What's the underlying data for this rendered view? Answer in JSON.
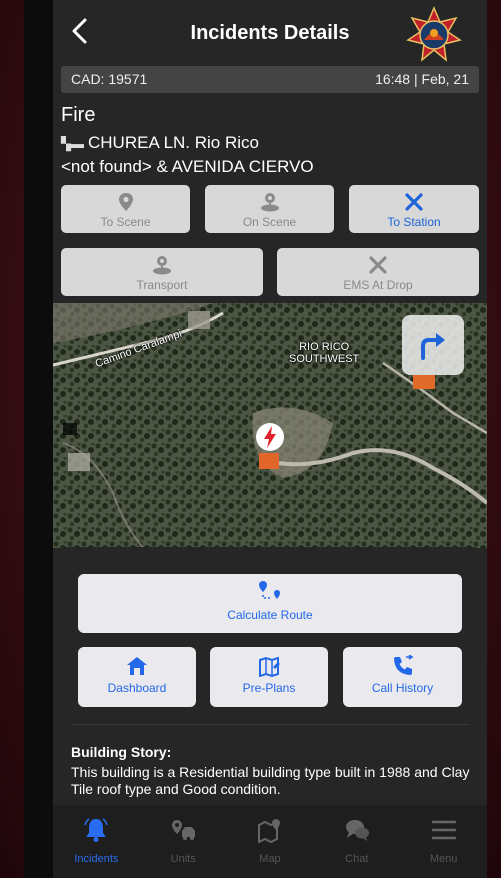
{
  "header": {
    "title": "Incidents Details"
  },
  "cad_bar": {
    "cad": "CAD: 19571",
    "time": "16:48 | Feb, 21"
  },
  "incident": {
    "type": "Fire",
    "address_line1": "CHUREA LN. Rio Rico",
    "address_line2": "<not found> & AVENIDA CIERVO"
  },
  "status_buttons": [
    {
      "label": "To Scene",
      "icon": "location-pin-icon",
      "active": false
    },
    {
      "label": "On Scene",
      "icon": "person-pin-icon",
      "active": false
    },
    {
      "label": "To Station",
      "icon": "close-x-icon",
      "active": true
    },
    {
      "label": "Transport",
      "icon": "person-pin-icon",
      "active": false
    },
    {
      "label": "EMS At Drop",
      "icon": "close-x-icon",
      "active": false
    }
  ],
  "map": {
    "street_label": "Camino Caralampi",
    "area_label_1": "RIO RICO",
    "area_label_2": "SOUTHWEST"
  },
  "actions": {
    "calculate_route": "Calculate Route",
    "dashboard": "Dashboard",
    "pre_plans": "Pre-Plans",
    "call_history": "Call History"
  },
  "building_story": {
    "title": "Building Story:",
    "text": "This building is a   Residential building type built in 1988 and Clay Tile roof type and Good condition."
  },
  "tabs": [
    {
      "label": "Incidents",
      "icon": "bell-icon",
      "active": true
    },
    {
      "label": "Units",
      "icon": "units-icon",
      "active": false
    },
    {
      "label": "Map",
      "icon": "map-pin-icon",
      "active": false
    },
    {
      "label": "Chat",
      "icon": "chat-icon",
      "active": false
    },
    {
      "label": "Menu",
      "icon": "menu-icon",
      "active": false
    }
  ],
  "colors": {
    "accent": "#2468ea",
    "active_tab": "#2a6cf0",
    "background": "#262626",
    "status_button": "#d8d8d8"
  }
}
